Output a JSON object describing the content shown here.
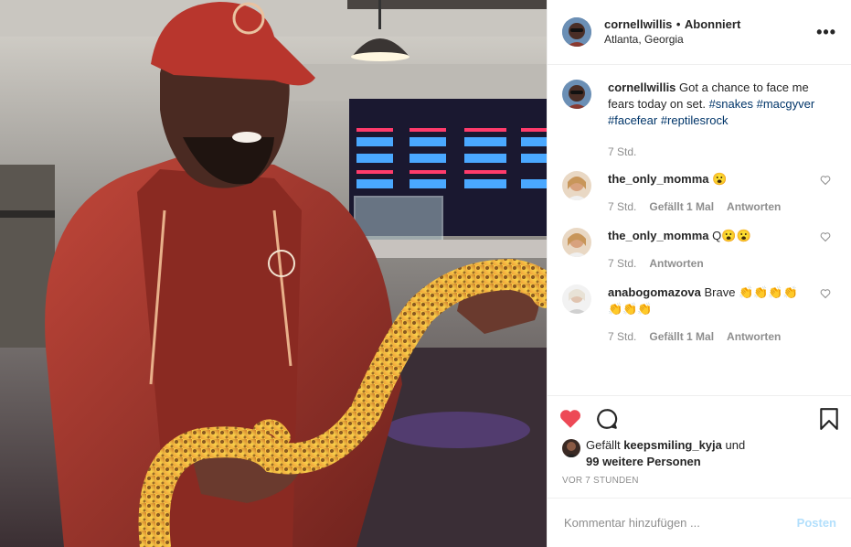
{
  "post": {
    "username": "cornellwillis",
    "separator": "•",
    "follow_status": "Abonniert",
    "location": "Atlanta, Georgia",
    "more_icon": "more-horizontal-icon"
  },
  "caption": {
    "username": "cornellwillis",
    "text": "Got a chance to face me fears today on set.",
    "hashtags": [
      "#snakes",
      "#macgyver",
      "#facefear",
      "#reptilesrock"
    ],
    "time": "7 Std."
  },
  "comments": [
    {
      "username": "the_only_momma",
      "text": "😮",
      "time": "7 Std.",
      "likes": "Gefällt 1 Mal",
      "reply": "Antworten"
    },
    {
      "username": "the_only_momma",
      "text": "Q😮😮",
      "time": "7 Std.",
      "likes": "",
      "reply": "Antworten"
    },
    {
      "username": "anabogomazova",
      "text": "Brave 👏👏👏👏👏👏👏",
      "time": "7 Std.",
      "likes": "Gefällt 1 Mal",
      "reply": "Antworten"
    }
  ],
  "actions": {
    "like_icon": "heart-filled-icon",
    "comment_icon": "comment-icon",
    "save_icon": "bookmark-icon",
    "like_color": "#ed4956"
  },
  "likes": {
    "prefix": "Gefällt",
    "user": "keepsmiling_kyja",
    "connector": "und",
    "others": "99 weitere Personen"
  },
  "timestamp": "VOR 7 STUNDEN",
  "composer": {
    "placeholder": "Kommentar hinzufügen ...",
    "post_label": "Posten"
  },
  "colors": {
    "link": "#003569",
    "muted": "#8e8e8e",
    "post_disabled": "#b2dffc"
  }
}
